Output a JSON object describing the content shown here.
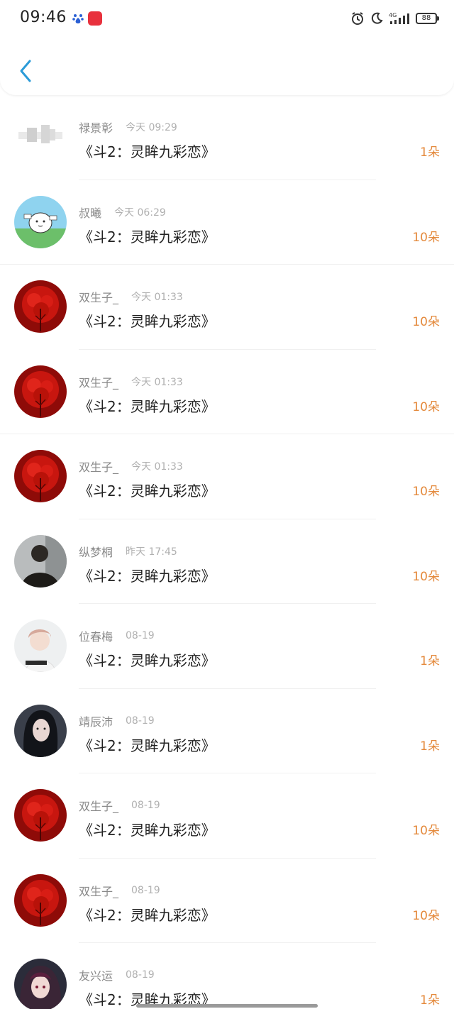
{
  "status_bar": {
    "time": "09:46",
    "network": "4G",
    "battery": "88"
  },
  "colors": {
    "accent_back": "#2b9bd8",
    "gift_count": "#e48a3d"
  },
  "icons": {
    "back": "chevron-left-icon",
    "alarm": "alarm-icon",
    "moon": "moon-icon",
    "signal": "signal-icon",
    "battery": "battery-icon"
  },
  "gifts": [
    {
      "user": "禄景彰",
      "time": "今天 09:29",
      "book": "《斗2：灵眸九彩恋》",
      "count": "1朵",
      "avatar": "sketch"
    },
    {
      "user": "叔曦",
      "time": "今天 06:29",
      "book": "《斗2：灵眸九彩恋》",
      "count": "10朵",
      "avatar": "cartoon"
    },
    {
      "user": "双生子_",
      "time": "今天 01:33",
      "book": "《斗2：灵眸九彩恋》",
      "count": "10朵",
      "avatar": "red-flower"
    },
    {
      "user": "双生子_",
      "time": "今天 01:33",
      "book": "《斗2：灵眸九彩恋》",
      "count": "10朵",
      "avatar": "red-flower"
    },
    {
      "user": "双生子_",
      "time": "今天 01:33",
      "book": "《斗2：灵眸九彩恋》",
      "count": "10朵",
      "avatar": "red-flower"
    },
    {
      "user": "纵梦桐",
      "time": "昨天 17:45",
      "book": "《斗2：灵眸九彩恋》",
      "count": "10朵",
      "avatar": "dark-figure"
    },
    {
      "user": "位春梅",
      "time": "08-19",
      "book": "《斗2：灵眸九彩恋》",
      "count": "1朵",
      "avatar": "portrait-light"
    },
    {
      "user": "靖辰沛",
      "time": "08-19",
      "book": "《斗2：灵眸九彩恋》",
      "count": "1朵",
      "avatar": "portrait-dark"
    },
    {
      "user": "双生子_",
      "time": "08-19",
      "book": "《斗2：灵眸九彩恋》",
      "count": "10朵",
      "avatar": "red-flower"
    },
    {
      "user": "双生子_",
      "time": "08-19",
      "book": "《斗2：灵眸九彩恋》",
      "count": "10朵",
      "avatar": "red-flower"
    },
    {
      "user": "友兴运",
      "time": "08-19",
      "book": "《斗2：灵眸九彩恋》",
      "count": "1朵",
      "avatar": "anime"
    }
  ]
}
